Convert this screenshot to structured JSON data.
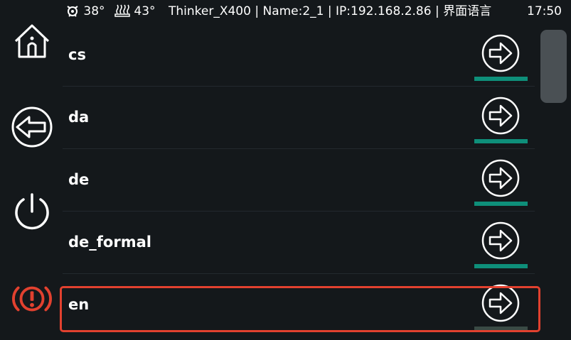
{
  "status": {
    "nozzle_temp": "38°",
    "bed_temp": "43°",
    "info": "Thinker_X400 | Name:2_1 | IP:192.168.2.86 | 界面语言",
    "time": "17:50"
  },
  "sidebar": {
    "items": [
      {
        "name": "home",
        "icon": "home-icon"
      },
      {
        "name": "back",
        "icon": "back-arrow-icon"
      },
      {
        "name": "power",
        "icon": "power-icon"
      },
      {
        "name": "emergency-stop",
        "icon": "alert-icon"
      }
    ]
  },
  "languages": [
    {
      "code": "cs"
    },
    {
      "code": "da"
    },
    {
      "code": "de"
    },
    {
      "code": "de_formal"
    },
    {
      "code": "en",
      "selected": true
    }
  ],
  "colors": {
    "background": "#14181b",
    "accent": "#0e8f7a",
    "alert": "#e2412f",
    "highlight_border": "#e2412f",
    "scroll_thumb": "#4a5054"
  }
}
